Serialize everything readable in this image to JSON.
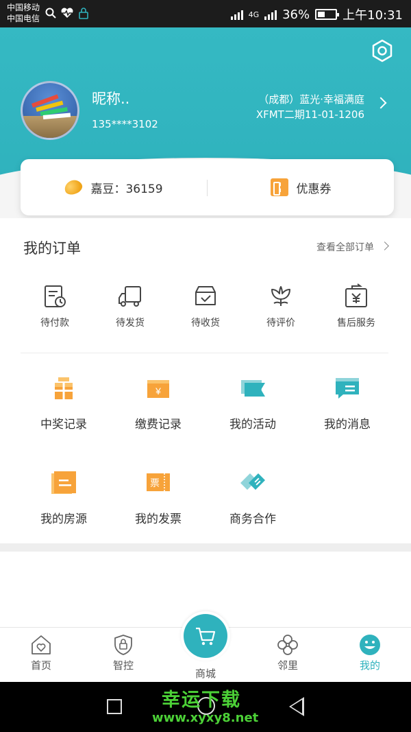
{
  "status_bar": {
    "carrier_1": "中国移动",
    "carrier_2": "中国电信",
    "network": "4G",
    "battery": "36%",
    "time": "上午10:31"
  },
  "profile": {
    "nickname": "昵称..",
    "phone": "135****3102",
    "address_line1": "（成都）蓝光·幸福满庭",
    "address_line2": "XFMT二期11-01-1206"
  },
  "summary_card": {
    "beans_label": "嘉豆：36159",
    "coupon_label": "优惠券"
  },
  "orders": {
    "title": "我的订单",
    "view_all": "查看全部订单",
    "items": [
      {
        "label": "待付款",
        "icon": "payment-pending-icon"
      },
      {
        "label": "待发货",
        "icon": "truck-icon"
      },
      {
        "label": "待收货",
        "icon": "box-check-icon"
      },
      {
        "label": "待评价",
        "icon": "flower-icon"
      },
      {
        "label": "售后服务",
        "icon": "refund-icon"
      }
    ]
  },
  "services": [
    {
      "label": "中奖记录",
      "icon": "gift-icon",
      "color": "#f7a33a"
    },
    {
      "label": "缴费记录",
      "icon": "yuan-card-icon",
      "color": "#f7a33a"
    },
    {
      "label": "我的活动",
      "icon": "flag-icon",
      "color": "#2fb2bd"
    },
    {
      "label": "我的消息",
      "icon": "message-icon",
      "color": "#2fb2bd"
    },
    {
      "label": "我的房源",
      "icon": "house-doc-icon",
      "color": "#f7a33a"
    },
    {
      "label": "我的发票",
      "icon": "ticket-icon",
      "color": "#f7a33a"
    },
    {
      "label": "商务合作",
      "icon": "handshake-icon",
      "color": "#2fb2bd"
    }
  ],
  "tabbar": {
    "items": [
      "首页",
      "智控",
      "商城",
      "邻里",
      "我的"
    ],
    "active": "我的"
  },
  "watermark": {
    "title": "幸运下载",
    "url": "www.xyxy8.net"
  },
  "colors": {
    "accent": "#2fb2bd",
    "orange": "#f7a33a"
  }
}
